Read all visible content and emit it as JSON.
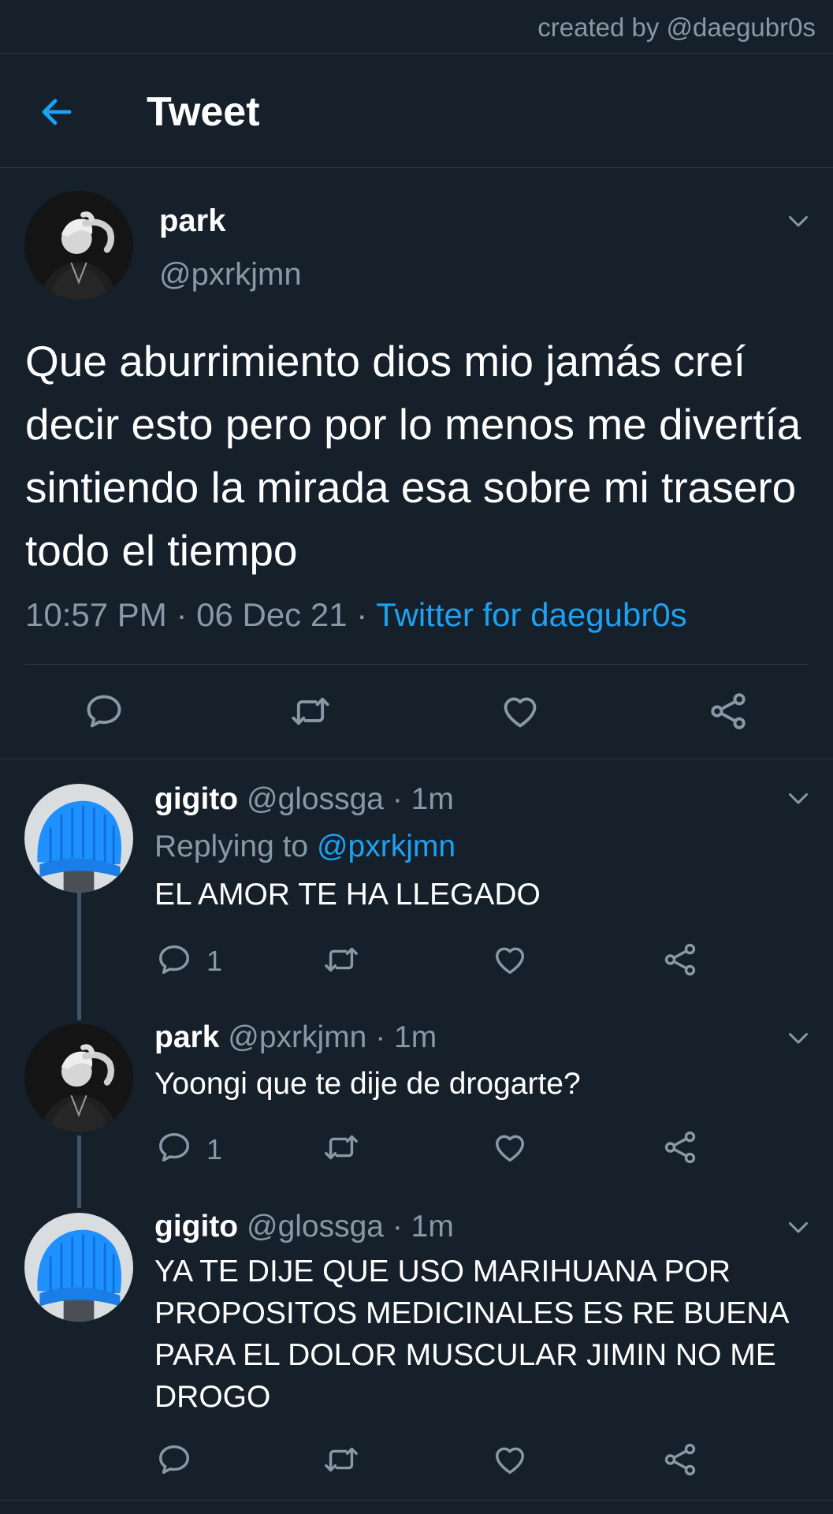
{
  "credit": "created by @daegubr0s",
  "header": {
    "title": "Tweet"
  },
  "main_tweet": {
    "name": "park",
    "handle": "@pxrkjmn",
    "text": "Que aburrimiento dios mio jamás creí decir esto pero por lo menos me divertía sintiendo la mirada esa sobre mi trasero todo el tiempo",
    "time": "10:57 PM",
    "date": "06 Dec 21",
    "source": "Twitter for daegubr0s"
  },
  "replies": [
    {
      "name": "gigito",
      "handle": "@glossga",
      "age": "1m",
      "replying_label": "Replying to",
      "replying_to": "@pxrkjmn",
      "text": "EL AMOR TE HA LLEGADO",
      "reply_count": "1"
    },
    {
      "name": "park",
      "handle": "@pxrkjmn",
      "age": "1m",
      "text": "Yoongi que te dije de drogarte?",
      "reply_count": "1"
    },
    {
      "name": "gigito",
      "handle": "@glossga",
      "age": "1m",
      "text": "YA TE DIJE QUE USO MARIHUANA POR PROPOSITOS MEDICINALES ES RE BUENA PARA EL DOLOR MUSCULAR JIMIN NO ME DROGO",
      "reply_count": ""
    }
  ],
  "icons": {
    "back": "arrow-left-icon",
    "chevron": "chevron-down-icon",
    "reply": "speech-bubble-icon",
    "retweet": "retweet-icon",
    "like": "heart-icon",
    "share": "share-icon"
  },
  "colors": {
    "background": "#15202b",
    "accent": "#1da1f2",
    "secondary_text": "#8899a6",
    "divider": "#2a3743",
    "beanie": "#1e90ff"
  }
}
